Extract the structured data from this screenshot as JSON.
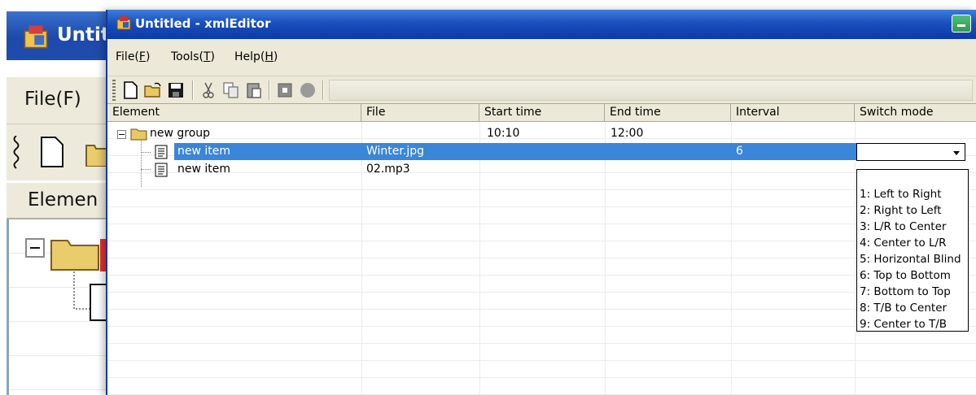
{
  "background_window": {
    "title": "Untit",
    "menu_label": "File(F)",
    "column_label": "Elemen"
  },
  "window": {
    "title": "Untitled - xmlEditor"
  },
  "menu": [
    {
      "label": "File(",
      "key": "F",
      "suffix": ")"
    },
    {
      "label": "Tools(",
      "key": "T",
      "suffix": ")"
    },
    {
      "label": "Help(",
      "key": "H",
      "suffix": ")"
    }
  ],
  "toolbar": {
    "icons": [
      "new-file-icon",
      "open-folder-icon",
      "save-icon",
      "cut-icon",
      "copy-icon",
      "paste-icon",
      "stop-icon",
      "record-icon"
    ]
  },
  "columns": [
    "Element",
    "File",
    "Start time",
    "End time",
    "Interval",
    "Switch mode"
  ],
  "rows": [
    {
      "element": "new group",
      "file": "",
      "start": "10:10",
      "end": "12:00",
      "interval": "",
      "switch": ""
    },
    {
      "element": "new item",
      "file": "Winter.jpg",
      "start": "",
      "end": "",
      "interval": "6",
      "switch": ""
    },
    {
      "element": "new item",
      "file": "02.mp3",
      "start": "",
      "end": "",
      "interval": "",
      "switch": ""
    }
  ],
  "switch_dropdown": {
    "value": "",
    "options": [
      "1: Left to Right",
      "2: Right to Left",
      "3: L/R to Center",
      "4: Center to L/R",
      "5: Horizontal Blind",
      "6: Top to Bottom",
      "7: Bottom to Top",
      "8: T/B to Center",
      "9: Center to T/B"
    ]
  },
  "colors": {
    "titlebar": "#0c3aa5",
    "selection": "#3a86d8",
    "chrome": "#ece9d8"
  }
}
